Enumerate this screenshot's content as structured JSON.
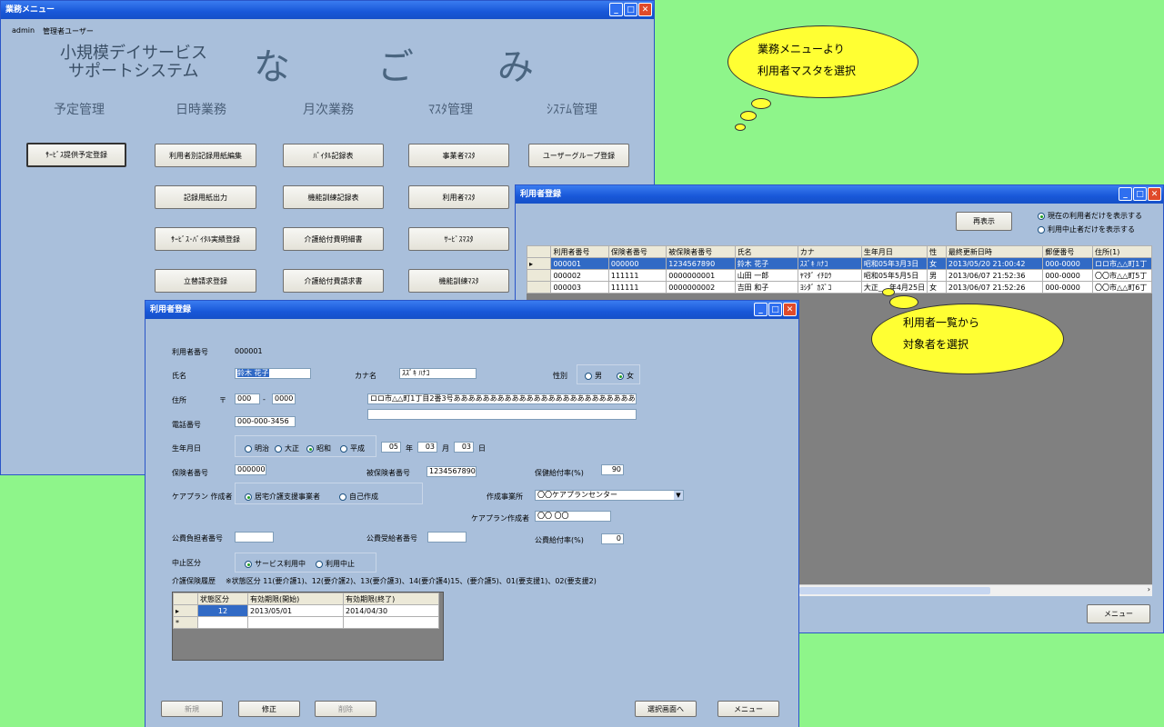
{
  "menu_window": {
    "title": "業務メニュー",
    "user_id": "admin",
    "user_name": "管理者ユーザー",
    "system_name_line1": "小規模デイサービス",
    "system_name_line2": "サポートシステム",
    "brand_chars": [
      "な",
      "ご",
      "み"
    ],
    "categories": [
      "予定管理",
      "日時業務",
      "月次業務",
      "ﾏｽﾀ管理",
      "ｼｽﾃﾑ管理"
    ],
    "buttons": {
      "service_plan": "ｻｰﾋﾞｽ提供予定登録",
      "user_record_edit": "利用者別記録用紙編集",
      "record_print": "記録用紙出力",
      "service_vital_register": "ｻｰﾋﾞｽ･ﾊﾞｲﾀﾙ実績登録",
      "advance_claim": "立替請求登録",
      "vital_record_table": "ﾊﾞｲﾀﾙ記録表",
      "training_record_table": "機能訓練記録表",
      "care_benefit_statement": "介護給付費明細書",
      "care_benefit_invoice": "介護給付費請求書",
      "provider_master": "事業者ﾏｽﾀ",
      "user_master": "利用者ﾏｽﾀ",
      "service_master": "ｻｰﾋﾞｽﾏｽﾀ",
      "training_master": "機能訓練ﾏｽﾀ",
      "user_group_register": "ユーザーグループ登録"
    }
  },
  "list_window": {
    "title": "利用者登録",
    "redisplay": "再表示",
    "filter_current": "現在の利用者だけを表示する",
    "filter_stopped": "利用中止者だけを表示する",
    "columns": [
      "利用者番号",
      "保険者番号",
      "被保険者番号",
      "氏名",
      "カナ",
      "生年月日",
      "性",
      "最終更新日時",
      "郵便番号",
      "住所(1)"
    ],
    "rows": [
      [
        "000001",
        "000000",
        "1234567890",
        "鈴木 花子",
        "ｽｽﾞｷ ﾊﾅｺ",
        "昭和05年3月3日",
        "女",
        "2013/05/20 21:00:42",
        "000-0000",
        "ロロ市△△町1丁"
      ],
      [
        "000002",
        "111111",
        "0000000001",
        "山田 一郎",
        "ﾔﾏﾀﾞ ｲﾁﾛｳ",
        "昭和05年5月5日",
        "男",
        "2013/06/07 21:52:36",
        "000-0000",
        "〇〇市△△町5丁"
      ],
      [
        "000003",
        "111111",
        "0000000002",
        "吉田 和子",
        "ﾖｼﾀﾞ ｶｽﾞｺ",
        "大正___年4月25日",
        "女",
        "2013/06/07 21:52:26",
        "000-0000",
        "〇〇市△△町6丁"
      ]
    ],
    "menu_button": "メニュー"
  },
  "detail_window": {
    "title": "利用者登録",
    "user_no_label": "利用者番号",
    "user_no": "000001",
    "name_label": "氏名",
    "name": "鈴木 花子",
    "kana_label": "カナ名",
    "kana": "ｽｽﾞｷ ﾊﾅｺ",
    "sex_label": "性別",
    "sex_male": "男",
    "sex_female": "女",
    "address_label": "住所",
    "postal_mark": "〒",
    "postal1": "000",
    "postal_dash": "-",
    "postal2": "0000",
    "address1": "ロロ市△△町1丁目2番3号ああああああああああああああああああああああああああ",
    "address2": "",
    "phone_label": "電話番号",
    "phone": "000-000-3456",
    "birth_label": "生年月日",
    "era_meiji": "明治",
    "era_taisho": "大正",
    "era_showa": "昭和",
    "era_heisei": "平成",
    "birth_year": "05",
    "year_unit": "年",
    "birth_month": "03",
    "month_unit": "月",
    "birth_day": "03",
    "day_unit": "日",
    "insurer_label": "保険者番号",
    "insurer": "000000",
    "insured_label": "被保険者番号",
    "insured": "1234567890",
    "benefit_rate_label": "保健給付率(%)",
    "benefit_rate": "90",
    "careplan_label": "ケアプラン 作成者",
    "careplan_provider": "居宅介護支援事業者",
    "careplan_self": "自己作成",
    "office_label": "作成事業所",
    "office": "〇〇ケアプランセンター",
    "planner_label": "ケアプラン作成者",
    "planner": "〇〇 〇〇",
    "public_burden_label": "公費負担者番号",
    "public_burden": "",
    "public_recipient_label": "公費受給者番号",
    "public_recipient": "",
    "public_rate_label": "公費給付率(%)",
    "public_rate": "0",
    "stop_label": "中止区分",
    "stop_in_use": "サービス利用中",
    "stop_stopped": "利用中止",
    "history_label": "介護保険履歴",
    "history_note": "※状態区分 11(要介護1)、12(要介護2)、13(要介護3)、14(要介護4)15、(要介護5)、01(要支援1)、02(要支援2)",
    "history_columns": [
      "状態区分",
      "有効期限(開始)",
      "有効期限(終了)"
    ],
    "history_rows": [
      [
        "12",
        "2013/05/01",
        "2014/04/30"
      ]
    ],
    "buttons": {
      "new": "新規",
      "edit": "修正",
      "delete": "削除",
      "select_screen": "選択画面へ",
      "menu": "メニュー"
    }
  },
  "callouts": {
    "callout1_line1": "業務メニューより",
    "callout1_line2": "利用者マスタを選択",
    "callout2_line1": "利用者一覧から",
    "callout2_line2": "対象者を選択"
  }
}
